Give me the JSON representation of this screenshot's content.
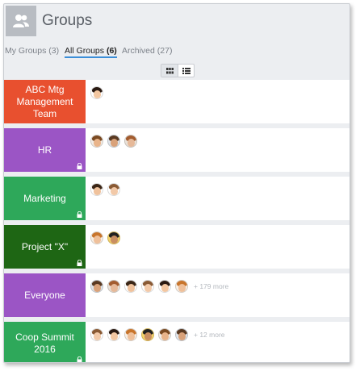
{
  "page": {
    "title": "Groups"
  },
  "tabs": [
    {
      "label": "My Groups",
      "count": "(3)"
    },
    {
      "label": "All Groups",
      "count": "(6)"
    },
    {
      "label": "Archived",
      "count": "(27)"
    }
  ],
  "view_modes": [
    {
      "name": "grid",
      "icon": "grid-icon"
    },
    {
      "name": "list",
      "icon": "list-icon"
    }
  ],
  "groups": [
    {
      "name": "ABC Mtg Management Team",
      "color": "#e8502f",
      "locked": false,
      "members": 1,
      "more": ""
    },
    {
      "name": "HR",
      "color": "#9b55c5",
      "locked": true,
      "members": 3,
      "more": ""
    },
    {
      "name": "Marketing",
      "color": "#2ea85a",
      "locked": true,
      "members": 2,
      "more": ""
    },
    {
      "name": "Project \"X\"",
      "color": "#1e6614",
      "locked": true,
      "members": 2,
      "more": ""
    },
    {
      "name": "Everyone",
      "color": "#9b55c5",
      "locked": false,
      "members": 6,
      "more": "+ 179 more"
    },
    {
      "name": "Coop Summit 2016",
      "color": "#2ea85a",
      "locked": true,
      "members": 6,
      "more": "+ 12 more"
    }
  ]
}
